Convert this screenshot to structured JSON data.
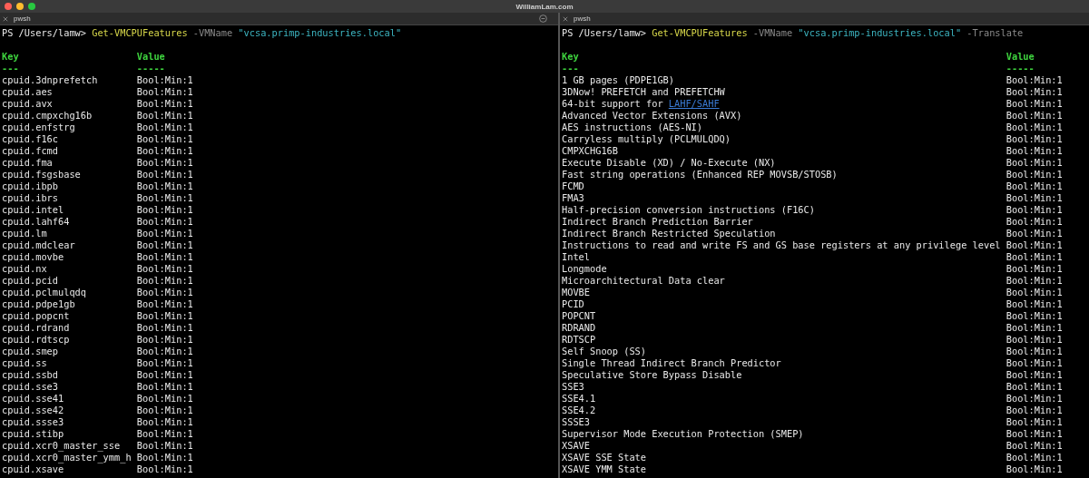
{
  "window": {
    "title": "WilliamLam.com"
  },
  "panes": [
    {
      "tab": {
        "label": "pwsh"
      },
      "split_button": true,
      "prompt": [
        {
          "kind": "path",
          "text": "PS /Users/lamw>"
        },
        {
          "kind": "command",
          "text": "Get-VMCPUFeatures"
        },
        {
          "kind": "parameter",
          "text": "-VMName"
        },
        {
          "kind": "string",
          "text": "\"vcsa.primp-industries.local\""
        }
      ],
      "columns": [
        {
          "heading": "Key",
          "underline": "---"
        },
        {
          "heading": "Value",
          "underline": "-----"
        }
      ],
      "rows": [
        {
          "key": "cpuid.3dnprefetch",
          "value": "Bool:Min:1"
        },
        {
          "key": "cpuid.aes",
          "value": "Bool:Min:1"
        },
        {
          "key": "cpuid.avx",
          "value": "Bool:Min:1"
        },
        {
          "key": "cpuid.cmpxchg16b",
          "value": "Bool:Min:1"
        },
        {
          "key": "cpuid.enfstrg",
          "value": "Bool:Min:1"
        },
        {
          "key": "cpuid.f16c",
          "value": "Bool:Min:1"
        },
        {
          "key": "cpuid.fcmd",
          "value": "Bool:Min:1"
        },
        {
          "key": "cpuid.fma",
          "value": "Bool:Min:1"
        },
        {
          "key": "cpuid.fsgsbase",
          "value": "Bool:Min:1"
        },
        {
          "key": "cpuid.ibpb",
          "value": "Bool:Min:1"
        },
        {
          "key": "cpuid.ibrs",
          "value": "Bool:Min:1"
        },
        {
          "key": "cpuid.intel",
          "value": "Bool:Min:1"
        },
        {
          "key": "cpuid.lahf64",
          "value": "Bool:Min:1"
        },
        {
          "key": "cpuid.lm",
          "value": "Bool:Min:1"
        },
        {
          "key": "cpuid.mdclear",
          "value": "Bool:Min:1"
        },
        {
          "key": "cpuid.movbe",
          "value": "Bool:Min:1"
        },
        {
          "key": "cpuid.nx",
          "value": "Bool:Min:1"
        },
        {
          "key": "cpuid.pcid",
          "value": "Bool:Min:1"
        },
        {
          "key": "cpuid.pclmulqdq",
          "value": "Bool:Min:1"
        },
        {
          "key": "cpuid.pdpe1gb",
          "value": "Bool:Min:1"
        },
        {
          "key": "cpuid.popcnt",
          "value": "Bool:Min:1"
        },
        {
          "key": "cpuid.rdrand",
          "value": "Bool:Min:1"
        },
        {
          "key": "cpuid.rdtscp",
          "value": "Bool:Min:1"
        },
        {
          "key": "cpuid.smep",
          "value": "Bool:Min:1"
        },
        {
          "key": "cpuid.ss",
          "value": "Bool:Min:1"
        },
        {
          "key": "cpuid.ssbd",
          "value": "Bool:Min:1"
        },
        {
          "key": "cpuid.sse3",
          "value": "Bool:Min:1"
        },
        {
          "key": "cpuid.sse41",
          "value": "Bool:Min:1"
        },
        {
          "key": "cpuid.sse42",
          "value": "Bool:Min:1"
        },
        {
          "key": "cpuid.ssse3",
          "value": "Bool:Min:1"
        },
        {
          "key": "cpuid.stibp",
          "value": "Bool:Min:1"
        },
        {
          "key": "cpuid.xcr0_master_sse",
          "value": "Bool:Min:1"
        },
        {
          "key": "cpuid.xcr0_master_ymm_h",
          "value": "Bool:Min:1"
        },
        {
          "key": "cpuid.xsave",
          "value": "Bool:Min:1"
        }
      ]
    },
    {
      "tab": {
        "label": "pwsh"
      },
      "split_button": false,
      "prompt": [
        {
          "kind": "path",
          "text": "PS /Users/lamw>"
        },
        {
          "kind": "command",
          "text": "Get-VMCPUFeatures"
        },
        {
          "kind": "parameter",
          "text": "-VMName"
        },
        {
          "kind": "string",
          "text": "\"vcsa.primp-industries.local\""
        },
        {
          "kind": "parameter",
          "text": "-Translate"
        }
      ],
      "columns": [
        {
          "heading": "Key",
          "underline": "---"
        },
        {
          "heading": "Value",
          "underline": "-----"
        }
      ],
      "rows": [
        {
          "key": "1 GB pages (PDPE1GB)",
          "value": "Bool:Min:1"
        },
        {
          "key": "3DNow! PREFETCH and PREFETCHW",
          "value": "Bool:Min:1"
        },
        {
          "key": "64-bit support for",
          "link": "LAHF/SAHF",
          "value": "Bool:Min:1"
        },
        {
          "key": "Advanced Vector Extensions (AVX)",
          "value": "Bool:Min:1"
        },
        {
          "key": "AES instructions (AES-NI)",
          "value": "Bool:Min:1"
        },
        {
          "key": "Carryless multiply (PCLMULQDQ)",
          "value": "Bool:Min:1"
        },
        {
          "key": "CMPXCHG16B",
          "value": "Bool:Min:1"
        },
        {
          "key": "Execute Disable (XD) / No-Execute (NX)",
          "value": "Bool:Min:1"
        },
        {
          "key": "Fast string operations (Enhanced REP MOVSB/STOSB)",
          "value": "Bool:Min:1"
        },
        {
          "key": "FCMD",
          "value": "Bool:Min:1"
        },
        {
          "key": "FMA3",
          "value": "Bool:Min:1"
        },
        {
          "key": "Half-precision conversion instructions (F16C)",
          "value": "Bool:Min:1"
        },
        {
          "key": "Indirect Branch Prediction Barrier",
          "value": "Bool:Min:1"
        },
        {
          "key": "Indirect Branch Restricted Speculation",
          "value": "Bool:Min:1"
        },
        {
          "key": "Instructions to read and write FS and GS base registers at any privilege level",
          "value": "Bool:Min:1"
        },
        {
          "key": "Intel",
          "value": "Bool:Min:1"
        },
        {
          "key": "Longmode",
          "value": "Bool:Min:1"
        },
        {
          "key": "Microarchitectural Data clear",
          "value": "Bool:Min:1"
        },
        {
          "key": "MOVBE",
          "value": "Bool:Min:1"
        },
        {
          "key": "PCID",
          "value": "Bool:Min:1"
        },
        {
          "key": "POPCNT",
          "value": "Bool:Min:1"
        },
        {
          "key": "RDRAND",
          "value": "Bool:Min:1"
        },
        {
          "key": "RDTSCP",
          "value": "Bool:Min:1"
        },
        {
          "key": "Self Snoop (SS)",
          "value": "Bool:Min:1"
        },
        {
          "key": "Single Thread Indirect Branch Predictor",
          "value": "Bool:Min:1"
        },
        {
          "key": "Speculative Store Bypass Disable",
          "value": "Bool:Min:1"
        },
        {
          "key": "SSE3",
          "value": "Bool:Min:1"
        },
        {
          "key": "SSE4.1",
          "value": "Bool:Min:1"
        },
        {
          "key": "SSE4.2",
          "value": "Bool:Min:1"
        },
        {
          "key": "SSSE3",
          "value": "Bool:Min:1"
        },
        {
          "key": "Supervisor Mode Execution Protection (SMEP)",
          "value": "Bool:Min:1"
        },
        {
          "key": "XSAVE",
          "value": "Bool:Min:1"
        },
        {
          "key": "XSAVE SSE State",
          "value": "Bool:Min:1"
        },
        {
          "key": "XSAVE YMM State",
          "value": "Bool:Min:1"
        }
      ]
    }
  ]
}
